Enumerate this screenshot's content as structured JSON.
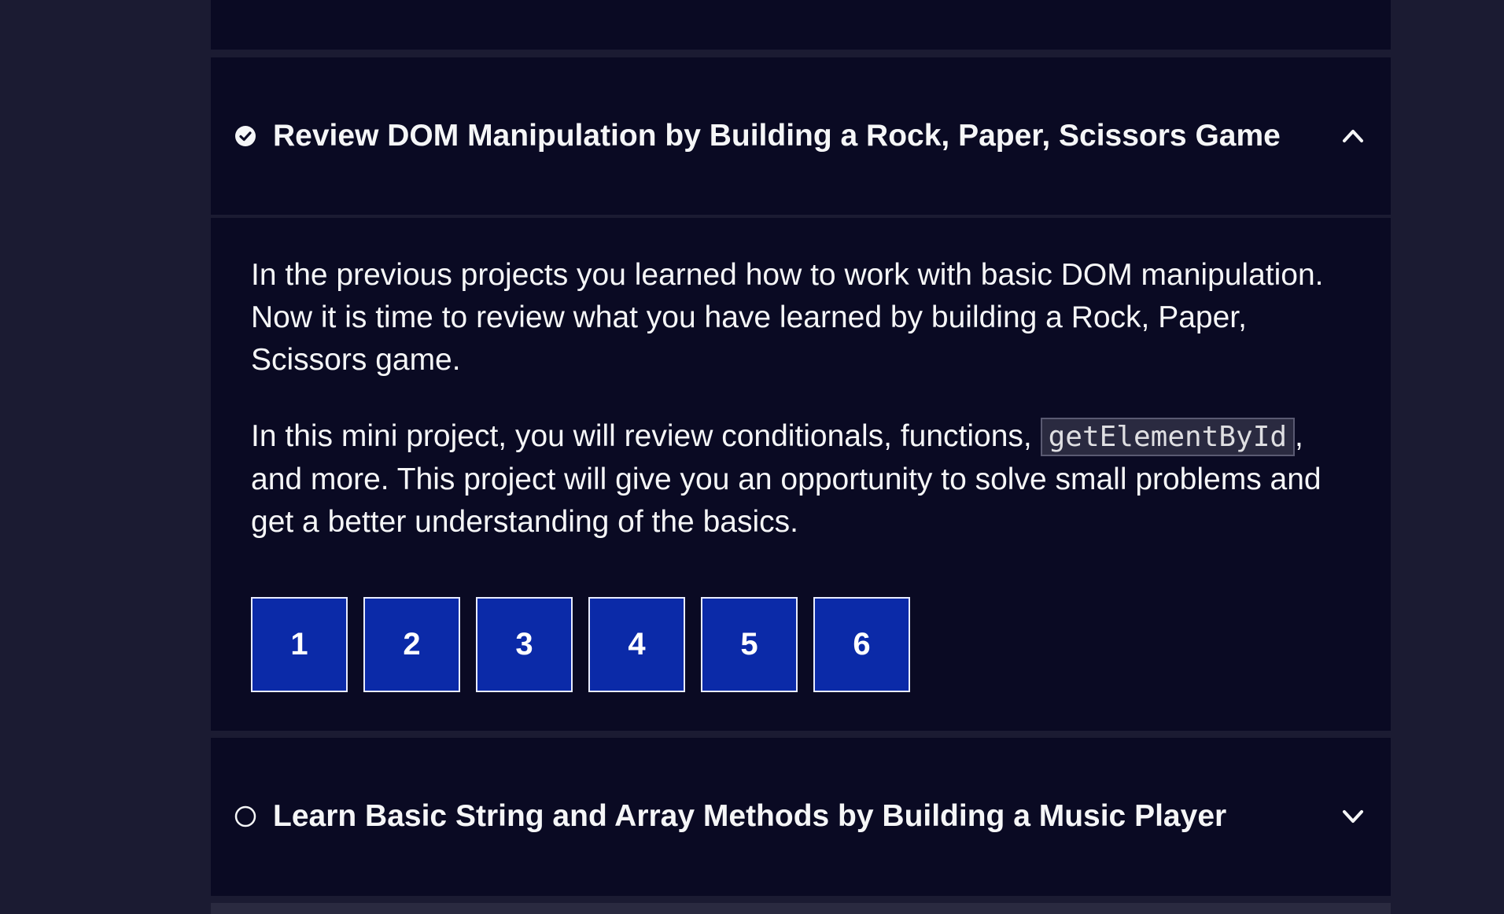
{
  "sections": [
    {
      "title": "Review DOM Manipulation by Building a Rock, Paper, Scissors Game",
      "status_icon": "check-circle-icon",
      "chevron_icon": "chevron-up-icon",
      "expanded": true,
      "paragraph_1": "In the previous projects you learned how to work with basic DOM manipulation. Now it is time to review what you have learned by building a Rock, Paper, Scissors game.",
      "paragraph_2_before": "In this mini project, you will review conditionals, functions, ",
      "paragraph_2_code": "getElementById",
      "paragraph_2_after": ", and more. This project will give you an opportunity to solve small problems and get a better understanding of the basics.",
      "steps": [
        "1",
        "2",
        "3",
        "4",
        "5",
        "6"
      ]
    },
    {
      "title": "Learn Basic String and Array Methods by Building a Music Player",
      "status_icon": "empty-circle-icon",
      "chevron_icon": "chevron-down-icon",
      "expanded": false
    }
  ],
  "colors": {
    "page_background": "#1b1b32",
    "panel_background": "#0a0a23",
    "step_background": "#0b2aa8",
    "text": "#f5f6f7"
  }
}
